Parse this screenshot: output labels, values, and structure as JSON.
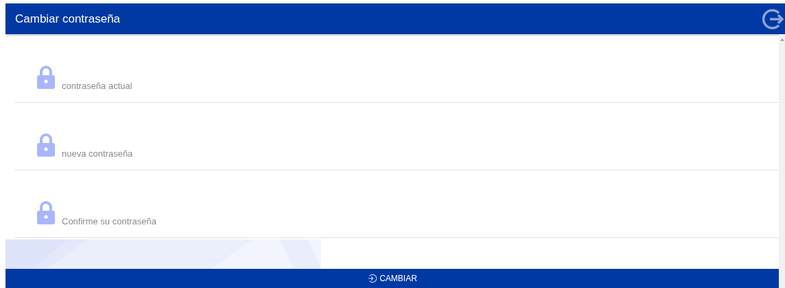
{
  "window": {
    "title": "Cambiar contraseña"
  },
  "fields": [
    {
      "placeholder": "contraseña actual"
    },
    {
      "placeholder": "nueva contraseña"
    },
    {
      "placeholder": "Confirme su contraseña"
    }
  ],
  "button": {
    "label": "CAMBIAR"
  }
}
